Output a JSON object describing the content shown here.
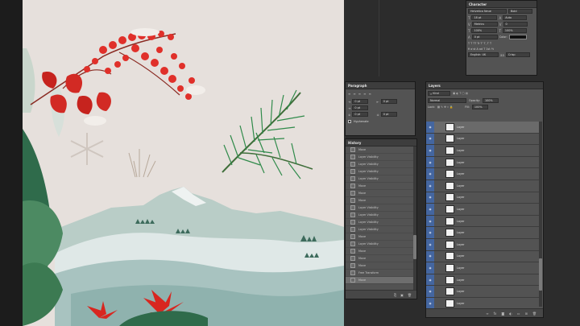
{
  "character_panel": {
    "title": "Character",
    "font_family": "Helvetica Neue",
    "font_style": "Bold",
    "font_size": "18 pt",
    "leading": "Auto",
    "kerning": "Metrics",
    "tracking": "0",
    "vscale": "100%",
    "hscale": "100%",
    "baseline": "0 pt",
    "color_label": "Color:",
    "language": "English: UK",
    "antialias": "Crisp"
  },
  "paragraph_panel": {
    "title": "Paragraph",
    "indent_left": "0 pt",
    "indent_right": "0 pt",
    "indent_first": "0 pt",
    "space_before": "0 pt",
    "space_after": "0 pt",
    "hyphenate": "Hyphenate"
  },
  "history_panel": {
    "title": "History",
    "items": [
      "Move",
      "Layer Visibility",
      "Layer Visibility",
      "Layer Visibility",
      "Layer Visibility",
      "Move",
      "Move",
      "Move",
      "Layer Visibility",
      "Layer Visibility",
      "Layer Visibility",
      "Layer Visibility",
      "Move",
      "Layer Visibility",
      "Move",
      "Move",
      "Move",
      "Free Transform",
      "Move"
    ]
  },
  "layers_panel": {
    "title": "Layers",
    "filter_kind": "Kind",
    "blend_mode": "Normal",
    "opacity_label": "Opacity:",
    "opacity": "100%",
    "lock_label": "Lock:",
    "fill_label": "Fill:",
    "fill": "100%",
    "layers": [
      "Layer",
      "Layer",
      "Layer",
      "Layer",
      "Layer",
      "Layer",
      "Layer",
      "Layer",
      "Layer",
      "Layer",
      "Layer",
      "Layer",
      "Layer",
      "Layer",
      "Layer",
      "Layer"
    ]
  },
  "colors": {
    "eye_column": "#4466a0",
    "panel_bg": "#535353",
    "canvas_bg": "#e6e0dc"
  }
}
